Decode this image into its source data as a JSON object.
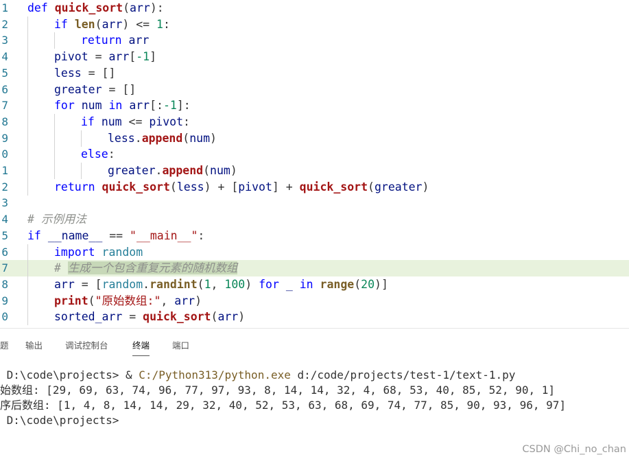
{
  "editor": {
    "line_numbers": [
      "1",
      "2",
      "3",
      "4",
      "5",
      "6",
      "7",
      "8",
      "9",
      "0",
      "1",
      "2",
      "3",
      "4",
      "5",
      "6",
      "7",
      "8",
      "9",
      "0"
    ],
    "lines": [
      [
        [
          "kw",
          "def "
        ],
        [
          "fn",
          "quick_sort"
        ],
        [
          "p",
          "("
        ],
        [
          "var",
          "arr"
        ],
        [
          "p",
          "):"
        ]
      ],
      [
        [
          "kw",
          "if "
        ],
        [
          "bfn",
          "len"
        ],
        [
          "p",
          "("
        ],
        [
          "var",
          "arr"
        ],
        [
          "p",
          ") <= "
        ],
        [
          "num",
          "1"
        ],
        [
          "p",
          ":"
        ]
      ],
      [
        [
          "kw",
          "return "
        ],
        [
          "var",
          "arr"
        ]
      ],
      [
        [
          "var",
          "pivot"
        ],
        [
          "p",
          " = "
        ],
        [
          "var",
          "arr"
        ],
        [
          "p",
          "["
        ],
        [
          "num",
          "-1"
        ],
        [
          "p",
          "]"
        ]
      ],
      [
        [
          "var",
          "less"
        ],
        [
          "p",
          " = []"
        ]
      ],
      [
        [
          "var",
          "greater"
        ],
        [
          "p",
          " = []"
        ]
      ],
      [
        [
          "kw",
          "for "
        ],
        [
          "var",
          "num"
        ],
        [
          "kw",
          " in "
        ],
        [
          "var",
          "arr"
        ],
        [
          "p",
          "[:"
        ],
        [
          "num",
          "-1"
        ],
        [
          "p",
          "]:"
        ]
      ],
      [
        [
          "kw",
          "if "
        ],
        [
          "var",
          "num"
        ],
        [
          "p",
          " <= "
        ],
        [
          "var",
          "pivot"
        ],
        [
          "p",
          ":"
        ]
      ],
      [
        [
          "var",
          "less"
        ],
        [
          "p",
          "."
        ],
        [
          "fn",
          "append"
        ],
        [
          "p",
          "("
        ],
        [
          "var",
          "num"
        ],
        [
          "p",
          ")"
        ]
      ],
      [
        [
          "kw",
          "else"
        ],
        [
          "p",
          ":"
        ]
      ],
      [
        [
          "var",
          "greater"
        ],
        [
          "p",
          "."
        ],
        [
          "fn",
          "append"
        ],
        [
          "p",
          "("
        ],
        [
          "var",
          "num"
        ],
        [
          "p",
          ")"
        ]
      ],
      [
        [
          "kw",
          "return "
        ],
        [
          "fn",
          "quick_sort"
        ],
        [
          "p",
          "("
        ],
        [
          "var",
          "less"
        ],
        [
          "p",
          ") + ["
        ],
        [
          "var",
          "pivot"
        ],
        [
          "p",
          "] + "
        ],
        [
          "fn",
          "quick_sort"
        ],
        [
          "p",
          "("
        ],
        [
          "var",
          "greater"
        ],
        [
          "p",
          ")"
        ]
      ],
      [],
      [
        [
          "cm",
          "# 示例用法"
        ]
      ],
      [
        [
          "kw",
          "if "
        ],
        [
          "var",
          "__name__"
        ],
        [
          "p",
          " == "
        ],
        [
          "str",
          "\"__main__\""
        ],
        [
          "p",
          ":"
        ]
      ],
      [
        [
          "kw",
          "import "
        ],
        [
          "mod",
          "random"
        ]
      ],
      [
        [
          "cm",
          "# "
        ],
        [
          "cm-sel",
          "生成一个包含重复元素的随机数组"
        ]
      ],
      [
        [
          "var",
          "arr"
        ],
        [
          "p",
          " = ["
        ],
        [
          "mod",
          "random"
        ],
        [
          "p",
          "."
        ],
        [
          "bfn",
          "randint"
        ],
        [
          "p",
          "("
        ],
        [
          "num",
          "1"
        ],
        [
          "p",
          ", "
        ],
        [
          "num",
          "100"
        ],
        [
          "p",
          ") "
        ],
        [
          "kw",
          "for "
        ],
        [
          "var",
          "_"
        ],
        [
          "kw",
          " in "
        ],
        [
          "bfn",
          "range"
        ],
        [
          "p",
          "("
        ],
        [
          "num",
          "20"
        ],
        [
          "p",
          ")]"
        ]
      ],
      [
        [
          "fn",
          "print"
        ],
        [
          "p",
          "("
        ],
        [
          "str",
          "\"原始数组:\""
        ],
        [
          "p",
          ", "
        ],
        [
          "var",
          "arr"
        ],
        [
          "p",
          ")"
        ]
      ],
      [
        [
          "var",
          "sorted_arr"
        ],
        [
          "p",
          " = "
        ],
        [
          "fn",
          "quick_sort"
        ],
        [
          "p",
          "("
        ],
        [
          "var",
          "arr"
        ],
        [
          "p",
          ")"
        ]
      ]
    ]
  },
  "panel": {
    "tabs": [
      "题",
      "输出",
      "调试控制台",
      "终端",
      "端口"
    ],
    "active_tab": "终端"
  },
  "terminal": {
    "line1_prompt": " D:\\code\\projects> & ",
    "line1_exe": "C:/Python313/python.exe",
    "line1_arg": " d:/code/projects/test-1/text-1.py",
    "line2": "始数组: [29, 69, 63, 74, 96, 77, 97, 93, 8, 14, 14, 32, 4, 68, 53, 40, 85, 52, 90, 1]",
    "line3": "序后数组: [1, 4, 8, 14, 14, 29, 32, 40, 52, 53, 63, 68, 69, 74, 77, 85, 90, 93, 96, 97]",
    "line4": " D:\\code\\projects>"
  },
  "watermark": "CSDN @Chi_no_chan"
}
